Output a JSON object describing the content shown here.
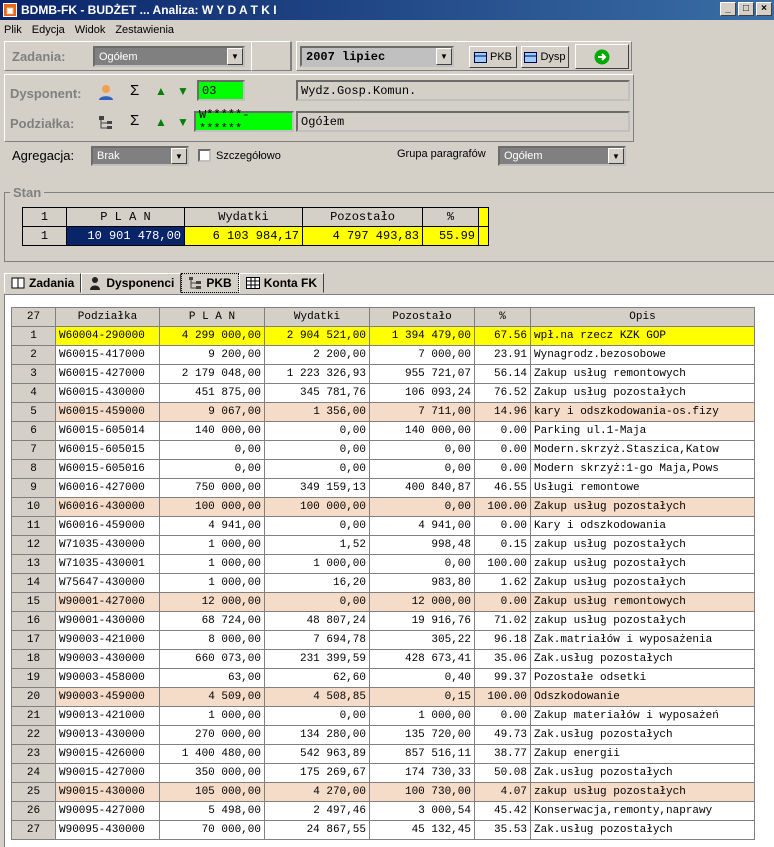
{
  "window": {
    "title": "BDMB-FK - BUDŻET ... Analiza:  W Y D A T K I",
    "minimize": "_",
    "maximize": "□",
    "close": "×"
  },
  "menu": [
    "Plik",
    "Edycja",
    "Widok",
    "Zestawienia"
  ],
  "toolbar": {
    "zadania_label": "Zadania:",
    "zadania_value": "Ogółem",
    "period_value": "2007 lipiec",
    "pkb_label": "PKB",
    "dysp_label": "Dysp"
  },
  "dysponent": {
    "label": "Dysponent:",
    "code": "03",
    "name": "Wydz.Gosp.Komun."
  },
  "podzialka": {
    "label": "Podziałka:",
    "code": "W*****-******",
    "name": "Ogółem"
  },
  "agregacja": {
    "label": "Agregacja:",
    "value": "Brak",
    "szczegolowo_label": "Szczegółowo",
    "grupa_label": "Grupa paragrafów",
    "grupa_value": "Ogółem"
  },
  "stan": {
    "legend": "Stan",
    "headers": [
      "1",
      "P L A N",
      "Wydatki",
      "Pozostało",
      "%"
    ],
    "row": [
      "1",
      "10 901 478,00",
      "6 103 984,17",
      "4 797 493,83",
      "55.99"
    ]
  },
  "tabs": [
    "Zadania",
    "Dysponenci",
    "PKB",
    "Konta FK"
  ],
  "grid": {
    "headers": [
      "27",
      "Podziałka",
      "P L A N",
      "Wydatki",
      "Pozostało",
      "%",
      "Opis"
    ],
    "rows": [
      [
        "1",
        "W60004-290000",
        "4 299 000,00",
        "2 904 521,00",
        "1 394 479,00",
        "67.56",
        "wpł.na rzecz KZK GOP"
      ],
      [
        "2",
        "W60015-417000",
        "9 200,00",
        "2 200,00",
        "7 000,00",
        "23.91",
        "Wynagrodz.bezosobowe"
      ],
      [
        "3",
        "W60015-427000",
        "2 179 048,00",
        "1 223 326,93",
        "955 721,07",
        "56.14",
        "Zakup usług remontowych"
      ],
      [
        "4",
        "W60015-430000",
        "451 875,00",
        "345 781,76",
        "106 093,24",
        "76.52",
        "Zakup usług pozostałych"
      ],
      [
        "5",
        "W60015-459000",
        "9 067,00",
        "1 356,00",
        "7 711,00",
        "14.96",
        "kary i odszkodowania-os.fizy"
      ],
      [
        "6",
        "W60015-605014",
        "140 000,00",
        "0,00",
        "140 000,00",
        "0.00",
        "Parking ul.1-Maja"
      ],
      [
        "7",
        "W60015-605015",
        "0,00",
        "0,00",
        "0,00",
        "0.00",
        "Modern.skrzyż.Staszica,Katow"
      ],
      [
        "8",
        "W60015-605016",
        "0,00",
        "0,00",
        "0,00",
        "0.00",
        "Modern skrzyż:1-go Maja,Pows"
      ],
      [
        "9",
        "W60016-427000",
        "750 000,00",
        "349 159,13",
        "400 840,87",
        "46.55",
        "Usługi remontowe"
      ],
      [
        "10",
        "W60016-430000",
        "100 000,00",
        "100 000,00",
        "0,00",
        "100.00",
        "Zakup usług pozostałych"
      ],
      [
        "11",
        "W60016-459000",
        "4 941,00",
        "0,00",
        "4 941,00",
        "0.00",
        "Kary i odszkodowania"
      ],
      [
        "12",
        "W71035-430000",
        "1 000,00",
        "1,52",
        "998,48",
        "0.15",
        "zakup usług pozostałych"
      ],
      [
        "13",
        "W71035-430001",
        "1 000,00",
        "1 000,00",
        "0,00",
        "100.00",
        "zakup usług pozostałych"
      ],
      [
        "14",
        "W75647-430000",
        "1 000,00",
        "16,20",
        "983,80",
        "1.62",
        "Zakup usług pozostałych"
      ],
      [
        "15",
        "W90001-427000",
        "12 000,00",
        "0,00",
        "12 000,00",
        "0.00",
        "Zakup usług remontowych"
      ],
      [
        "16",
        "W90001-430000",
        "68 724,00",
        "48 807,24",
        "19 916,76",
        "71.02",
        "zakup usług pozostałych"
      ],
      [
        "17",
        "W90003-421000",
        "8 000,00",
        "7 694,78",
        "305,22",
        "96.18",
        "Zak.matriałów i wyposażenia"
      ],
      [
        "18",
        "W90003-430000",
        "660 073,00",
        "231 399,59",
        "428 673,41",
        "35.06",
        "Zak.usług pozostałych"
      ],
      [
        "19",
        "W90003-458000",
        "63,00",
        "62,60",
        "0,40",
        "99.37",
        "Pozostałe odsetki"
      ],
      [
        "20",
        "W90003-459000",
        "4 509,00",
        "4 508,85",
        "0,15",
        "100.00",
        "Odszkodowanie"
      ],
      [
        "21",
        "W90013-421000",
        "1 000,00",
        "0,00",
        "1 000,00",
        "0.00",
        "Zakup materiałów i wyposażeń"
      ],
      [
        "22",
        "W90013-430000",
        "270 000,00",
        "134 280,00",
        "135 720,00",
        "49.73",
        "Zak.usług pozostałych"
      ],
      [
        "23",
        "W90015-426000",
        "1 400 480,00",
        "542 963,89",
        "857 516,11",
        "38.77",
        "Zakup energii"
      ],
      [
        "24",
        "W90015-427000",
        "350 000,00",
        "175 269,67",
        "174 730,33",
        "50.08",
        "Zak.usług pozostałych"
      ],
      [
        "25",
        "W90015-430000",
        "105 000,00",
        "4 270,00",
        "100 730,00",
        "4.07",
        "zakup usług pozostałych"
      ],
      [
        "26",
        "W90095-427000",
        "5 498,00",
        "2 497,46",
        "3 000,54",
        "45.42",
        "Konserwacja,remonty,naprawy"
      ],
      [
        "27",
        "W90095-430000",
        "70 000,00",
        "24 867,55",
        "45 132,45",
        "35.53",
        "Zak.usług pozostałych"
      ]
    ]
  },
  "colors": {
    "highlight_row": "#ffff00",
    "zero_row": "#f5dcc8",
    "selected_plan": "#0a246a"
  }
}
